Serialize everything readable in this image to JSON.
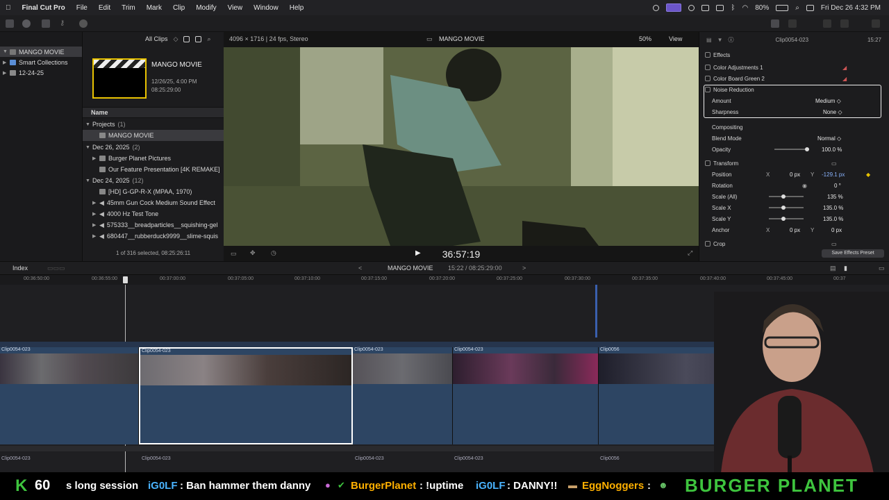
{
  "menubar": {
    "app": "Final Cut Pro",
    "items": [
      "File",
      "Edit",
      "Trim",
      "Mark",
      "Clip",
      "Modify",
      "View",
      "Window",
      "Help"
    ],
    "battery": "80%",
    "datetime": "Fri Dec 26  4:32 PM"
  },
  "library": {
    "items": [
      {
        "label": "MANGO MOVIE"
      },
      {
        "label": "Smart Collections"
      },
      {
        "label": "12-24-25"
      }
    ]
  },
  "browser": {
    "filter": "All Clips",
    "project_title": "MANGO MOVIE",
    "project_date": "12/26/25, 4:00 PM",
    "project_duration": "08:25:29:00",
    "column_name": "Name",
    "rows": [
      {
        "label": "Projects",
        "count": "(1)"
      },
      {
        "label": "MANGO MOVIE"
      },
      {
        "label": "Dec 26, 2025",
        "count": "(2)"
      },
      {
        "label": "Burger Planet Pictures"
      },
      {
        "label": "Our Feature Presentation [4K REMAKE]"
      },
      {
        "label": "Dec 24, 2025",
        "count": "(12)"
      },
      {
        "label": "[HD] G-GP-R-X (MPAA, 1970)"
      },
      {
        "label": "45mm Gun Cock Medium Sound Effect"
      },
      {
        "label": "4000 Hz Test Tone"
      },
      {
        "label": "575333__breadparticles__squishing-gel"
      },
      {
        "label": "680447__rubberduck9999__slime-squis"
      }
    ],
    "footer": "1 of 316 selected, 08:25:26:11"
  },
  "viewer": {
    "format": "4096 × 1716 | 24 fps, Stereo",
    "title": "MANGO MOVIE",
    "zoom": "50%",
    "view_label": "View",
    "timecode": "36:57:19"
  },
  "inspector": {
    "clip_name": "Clip0054-023",
    "clip_duration": "15:27",
    "effects_header": "Effects",
    "effects": [
      "Color Adjustments 1",
      "Color Board Green 2"
    ],
    "noise_reduction": "Noise Reduction",
    "amount_label": "Amount",
    "amount_value": "Medium ◇",
    "sharpness_label": "Sharpness",
    "sharpness_value": "None ◇",
    "compositing": "Compositing",
    "blend_label": "Blend Mode",
    "blend_value": "Normal ◇",
    "opacity_label": "Opacity",
    "opacity_value": "100.0 %",
    "transform": "Transform",
    "position_label": "Position",
    "pos_x_label": "X",
    "pos_x": "0 px",
    "pos_y_label": "Y",
    "pos_y": "-129.1 px",
    "rotation_label": "Rotation",
    "rotation_value": "0 °",
    "scale_all_label": "Scale (All)",
    "scale_all": "135 %",
    "scale_x_label": "Scale X",
    "scale_x": "135.0 %",
    "scale_y_label": "Scale Y",
    "scale_y": "135.0 %",
    "anchor_label": "Anchor",
    "anchor_x_label": "X",
    "anchor_x": "0 px",
    "anchor_y_label": "Y",
    "anchor_y": "0 px",
    "crop": "Crop",
    "save_preset": "Save Effects Preset"
  },
  "timeline": {
    "index_label": "Index",
    "project": "MANGO MOVIE",
    "position": "15:22 / 08:25:29:00",
    "ruler": [
      "00:36:50:00",
      "00:36:55:00",
      "00:37:00:00",
      "00:37:05:00",
      "00:37:10:00",
      "00:37:15:00",
      "00:37:20:00",
      "00:37:25:00",
      "00:37:30:00",
      "00:37:35:00",
      "00:37:40:00",
      "00:37:45:00",
      "00:37"
    ],
    "clips": [
      "Clip0054-023",
      "Clip0054-023",
      "Clip0054-023",
      "Clip0054-023",
      "Clip0056"
    ],
    "audio_labels": [
      "Clip0054-023",
      "Clip0054-023",
      "Clip0054-023",
      "Clip0054-023",
      "Clip0056"
    ]
  },
  "ticker": {
    "badge_letter": "K",
    "badge_count": "60",
    "text": "s long session",
    "msgs": [
      {
        "user": "iG0LF",
        "text": ": Ban hammer them danny"
      },
      {
        "user": "BurgerPlanet",
        "text": ": !uptime"
      },
      {
        "user": "iG0LF",
        "text": ": DANNY!!"
      },
      {
        "user": "EggNoggers",
        "text": ":"
      }
    ],
    "brand": "BURGER PLANET"
  },
  "colors": {
    "accent_yellow": "#e9c300",
    "clip_blue": "#2d4563",
    "ticker_green": "#3ec43e",
    "ticker_blue": "#4ab4ff",
    "ticker_orange": "#ffb000"
  }
}
